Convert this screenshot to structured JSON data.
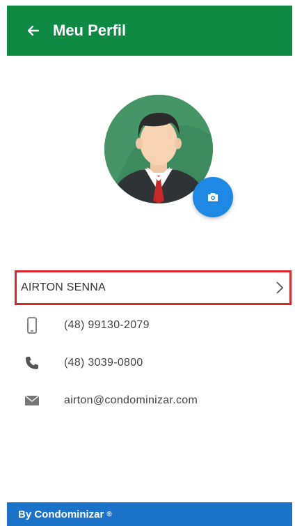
{
  "header": {
    "title": "Meu Perfil",
    "back_icon": "arrow-left-icon",
    "background": "#0f8a43"
  },
  "profile": {
    "avatar_icon": "businessman-avatar",
    "camera_icon": "camera-icon",
    "name": "AIRTON SENNA",
    "chevron_icon": "chevron-right-icon"
  },
  "contacts": [
    {
      "icon": "mobile-phone-icon",
      "value": "(48) 99130-2079"
    },
    {
      "icon": "phone-icon",
      "value": "(48) 3039-0800"
    },
    {
      "icon": "envelope-icon",
      "value": "airton@condominizar.com"
    }
  ],
  "footer": {
    "text": "By Condominizar",
    "mark": "®",
    "background": "#1a73c8"
  }
}
